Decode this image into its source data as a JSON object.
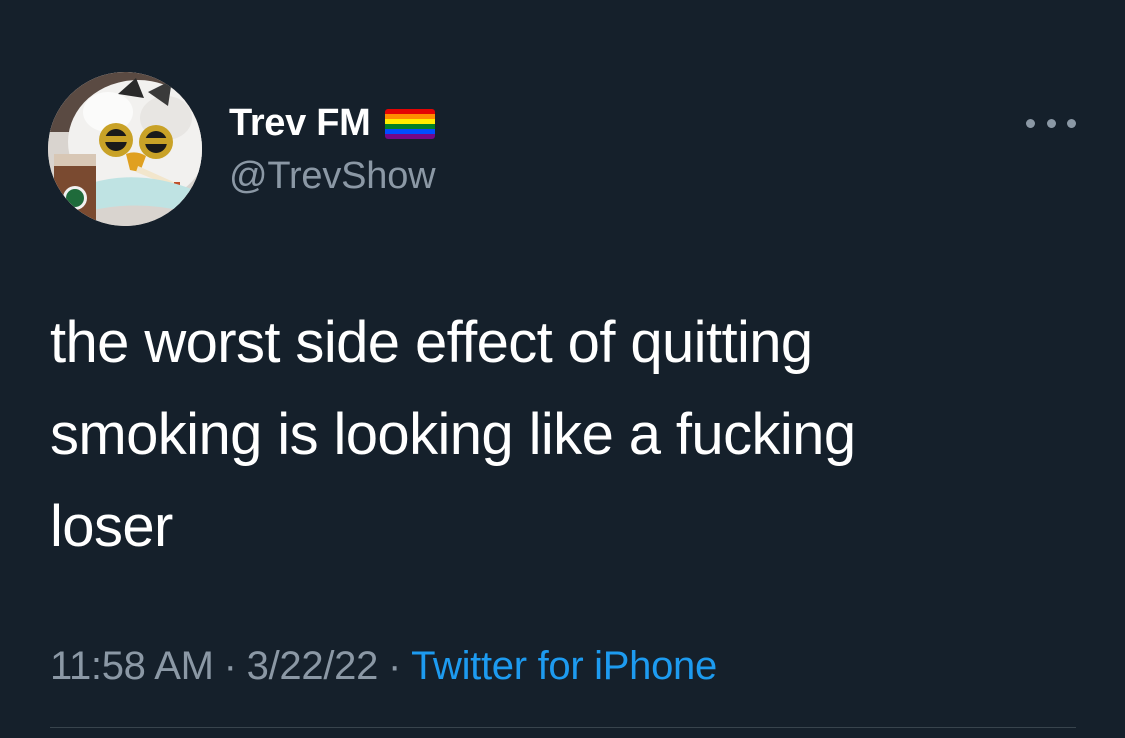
{
  "author": {
    "display_name": "Trev FM",
    "handle": "@TrevShow",
    "avatar_icon": "furby-avatar",
    "badge_icon": "rainbow-flag-icon"
  },
  "tweet": {
    "text_lines": [
      "the worst side effect of quitting",
      "smoking is looking like a fucking",
      "loser"
    ]
  },
  "meta": {
    "time": "11:58 AM",
    "separator": "·",
    "date": "3/22/22",
    "source": "Twitter for iPhone"
  },
  "colors": {
    "background": "#15202b",
    "primary_text": "#ffffff",
    "secondary_text": "#8b98a5",
    "link": "#1d9bf0",
    "flag": [
      "#e40303",
      "#ff8c00",
      "#ffed00",
      "#008026",
      "#004dff",
      "#750787"
    ]
  },
  "more_menu_icon": "more-horizontal-icon"
}
